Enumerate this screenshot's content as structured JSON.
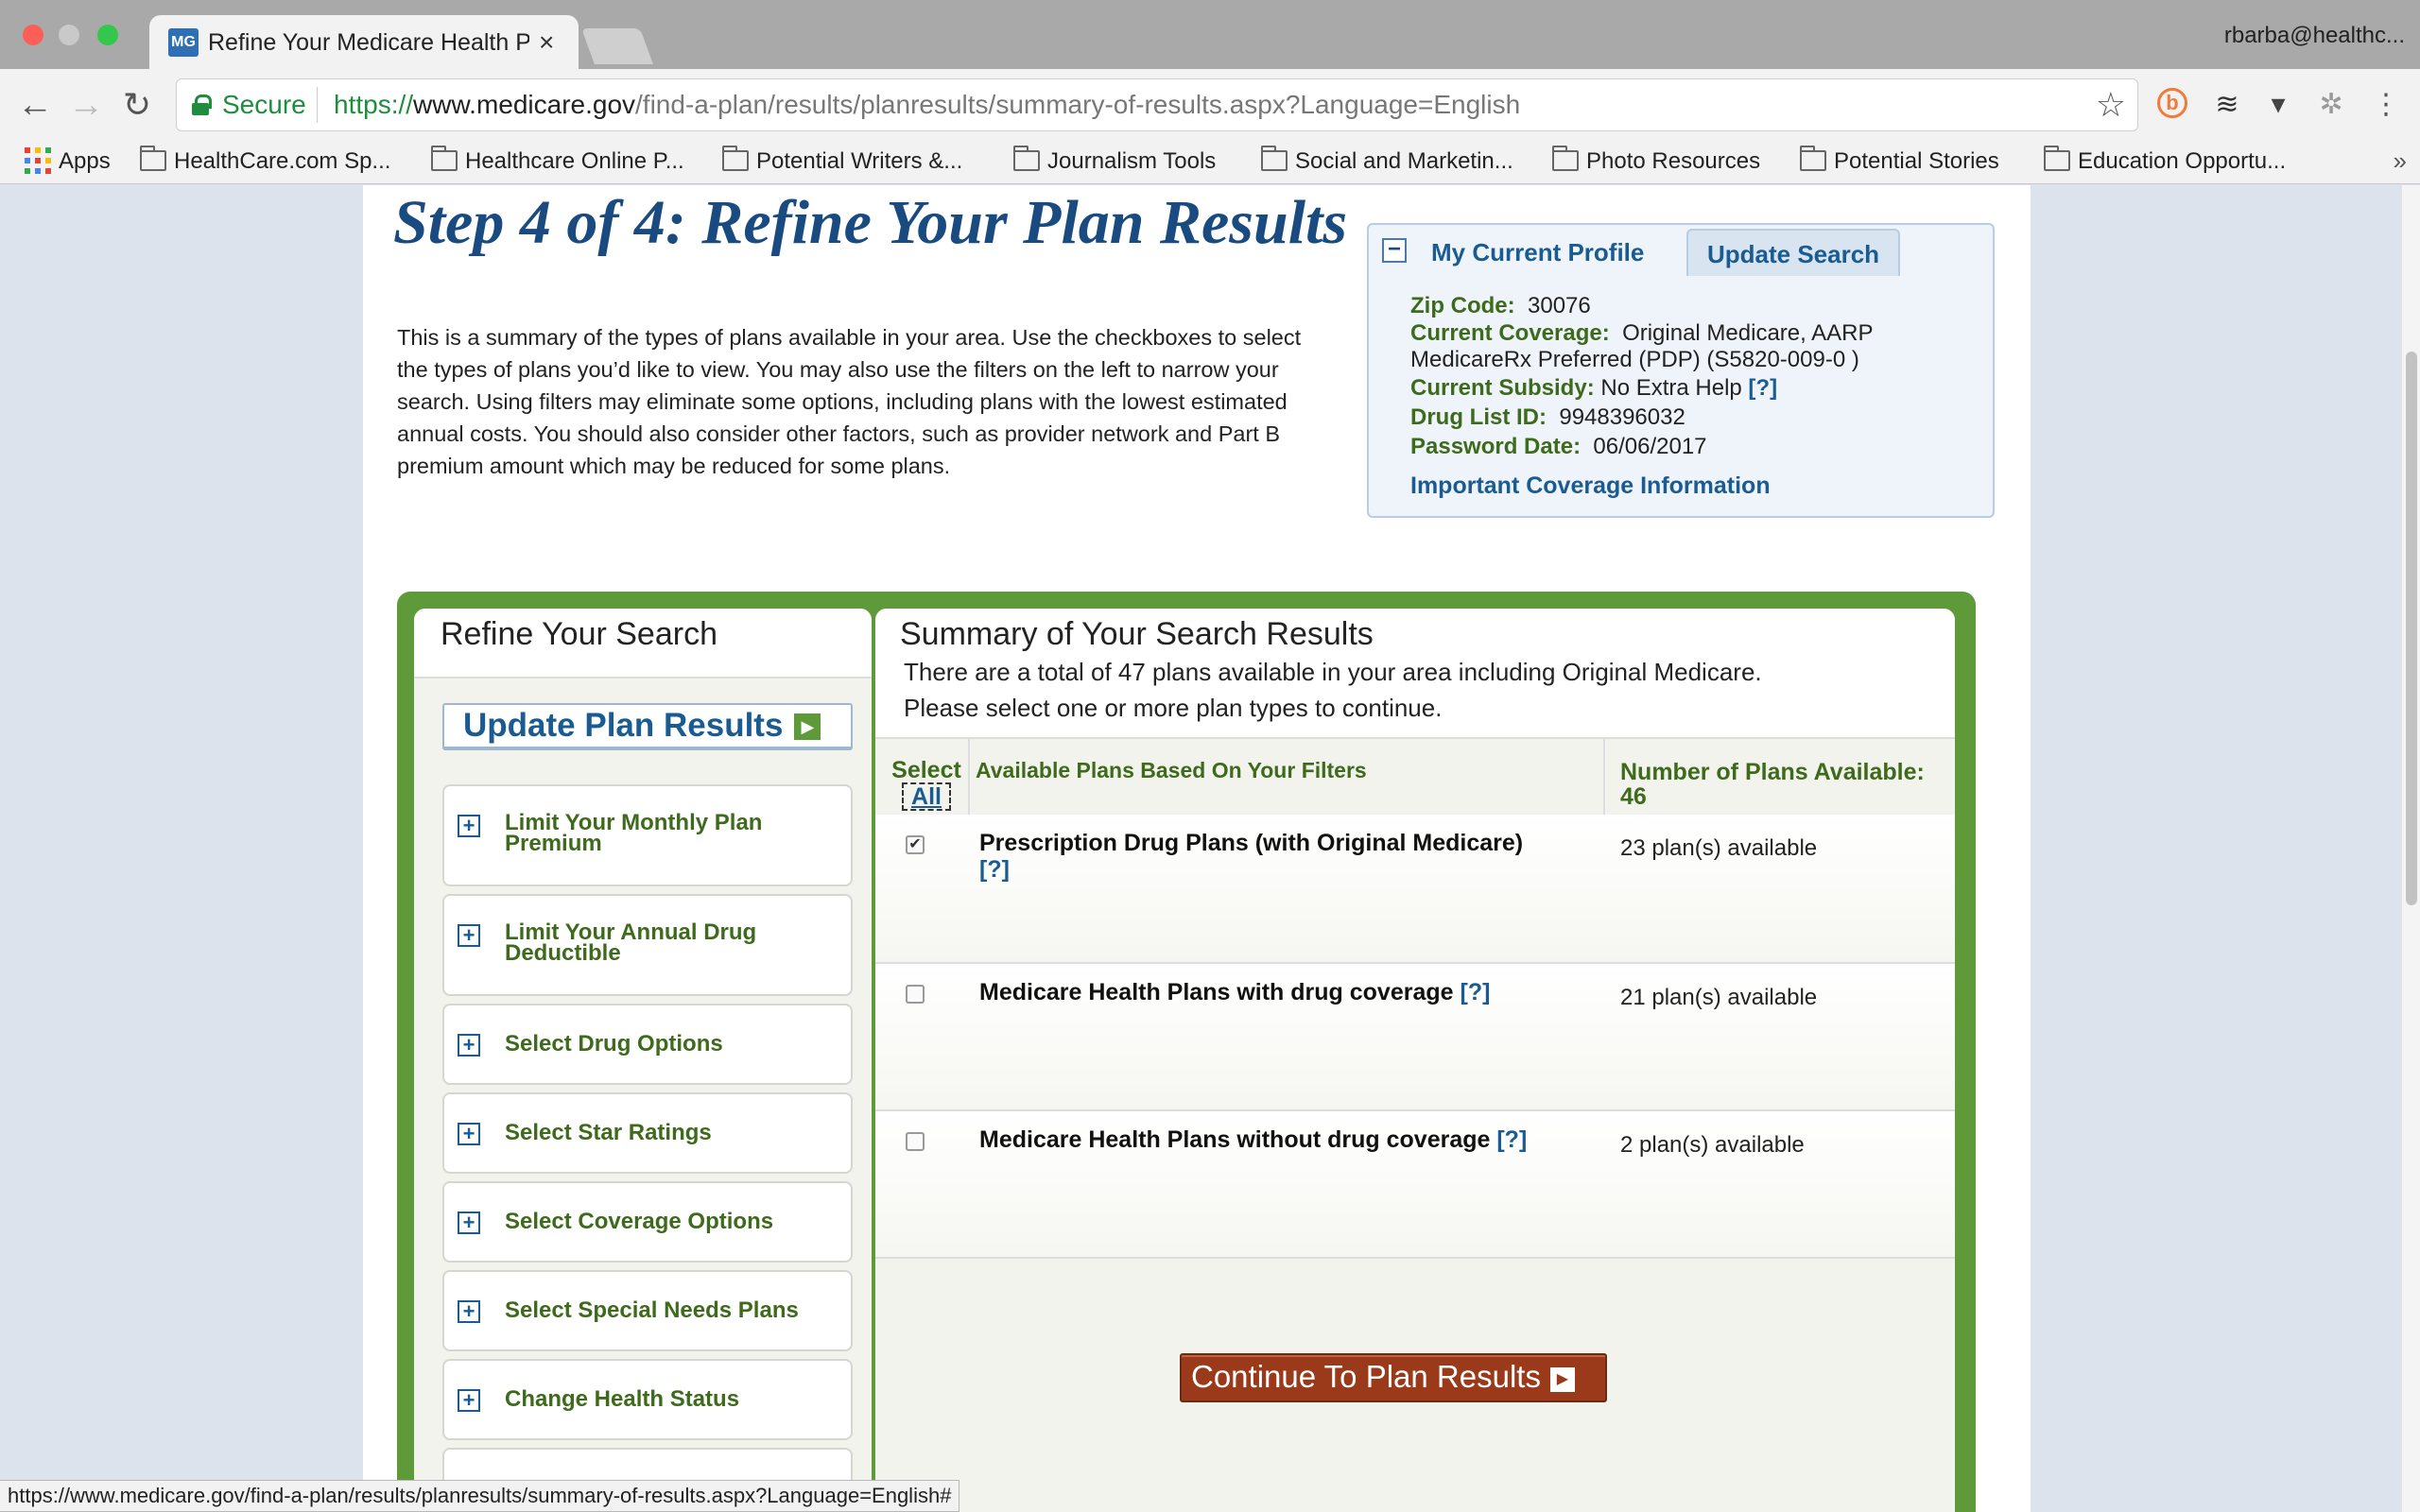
{
  "browser": {
    "tab_title": "Refine Your Medicare Health P",
    "profile_name": "rbarba@healthc...",
    "secure_label": "Secure",
    "url_proto": "https://",
    "url_host": "www.medicare.gov",
    "url_path": "/find-a-plan/results/planresults/summary-of-results.aspx?Language=English",
    "favicon_text": "MG",
    "bookmarks": [
      "Apps",
      "HealthCare.com Sp...",
      "Healthcare Online P...",
      "Potential Writers &...",
      "Journalism Tools",
      "Social and Marketin...",
      "Photo Resources",
      "Potential Stories",
      "Education Opportu..."
    ],
    "status_url": "https://www.medicare.gov/find-a-plan/results/planresults/summary-of-results.aspx?Language=English#"
  },
  "page": {
    "title": "Step 4 of 4: Refine Your Plan Results",
    "intro": "This is a summary of the types of plans available in your area. Use the checkboxes to select the types of plans you’d like to view. You may also use the filters on the left to narrow your search. Using filters may eliminate some options, including plans with the lowest estimated annual costs. You should also consider other factors, such as provider network and Part B premium amount which may be reduced for some plans."
  },
  "profile": {
    "tab_profile": "My Current Profile",
    "tab_update": "Update Search",
    "zip_label": "Zip Code:",
    "zip_value": "30076",
    "coverage_label": "Current Coverage:",
    "coverage_value": "Original Medicare, AARP MedicareRx Preferred (PDP) (S5820-009-0 )",
    "subsidy_label": "Current Subsidy:",
    "subsidy_value": "No Extra Help",
    "help_text": "[?]",
    "druglist_label": "Drug List ID:",
    "druglist_value": "9948396032",
    "password_label": "Password Date:",
    "password_value": "06/06/2017",
    "info_link": "Important Coverage Information"
  },
  "sidebar": {
    "title": "Refine Your Search",
    "update_button": "Update Plan Results",
    "filters": [
      "Limit Your Monthly Plan Premium",
      "Limit Your Annual Drug Deductible",
      "Select Drug Options",
      "Select Star Ratings",
      "Select Coverage Options",
      "Select Special Needs Plans",
      "Change Health Status"
    ]
  },
  "results": {
    "title": "Summary of Your Search Results",
    "desc_line1": "There are a total of 47 plans available in your area including Original Medicare.",
    "desc_line2": "Please select one or more plan types to continue.",
    "header_select": "Select",
    "header_select_all": "All",
    "header_plans": "Available Plans Based On Your Filters",
    "header_count": "Number of Plans Available:  46",
    "rows": [
      {
        "name": "Prescription Drug Plans (with Original Medicare)",
        "help": "[?]",
        "count": "23 plan(s) available",
        "checked": true
      },
      {
        "name": "Medicare Health Plans with drug coverage",
        "help": "[?]",
        "count": "21 plan(s) available",
        "checked": false
      },
      {
        "name": "Medicare Health Plans without drug coverage",
        "help": "[?]",
        "count": "2 plan(s) available",
        "checked": false
      }
    ],
    "continue_button": "Continue To Plan Results"
  }
}
